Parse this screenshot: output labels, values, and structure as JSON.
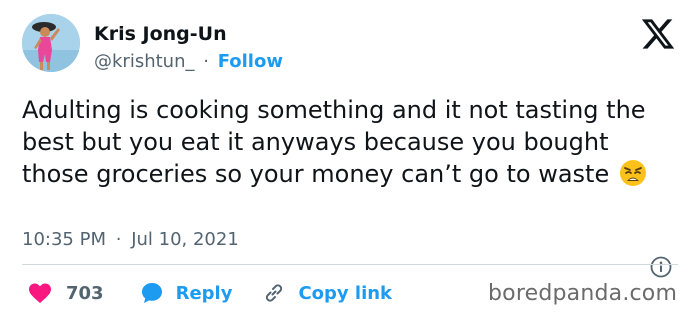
{
  "author": {
    "name": "Kris Jong-Un",
    "handle": "@krishtun_",
    "separator": "·",
    "follow_label": "Follow"
  },
  "brand": {
    "logo_icon": "x-logo-icon"
  },
  "tweet": {
    "text": "Adulting is cooking something and it not tasting the best but you eat it anyways because you bought those groceries so your money can’t go to waste",
    "emoji_icon": "weary-face-emoji-icon",
    "time": "10:35 PM",
    "separator": "·",
    "date": "Jul 10, 2021"
  },
  "actions": {
    "like_count": "703",
    "reply_label": "Reply",
    "copy_link_label": "Copy link"
  },
  "watermark": {
    "text": "boredpanda.com"
  },
  "colors": {
    "text": "#0f1419",
    "secondary": "#536471",
    "accent": "#1d9bf0",
    "like": "#f91880",
    "divider": "#cfd9de"
  }
}
